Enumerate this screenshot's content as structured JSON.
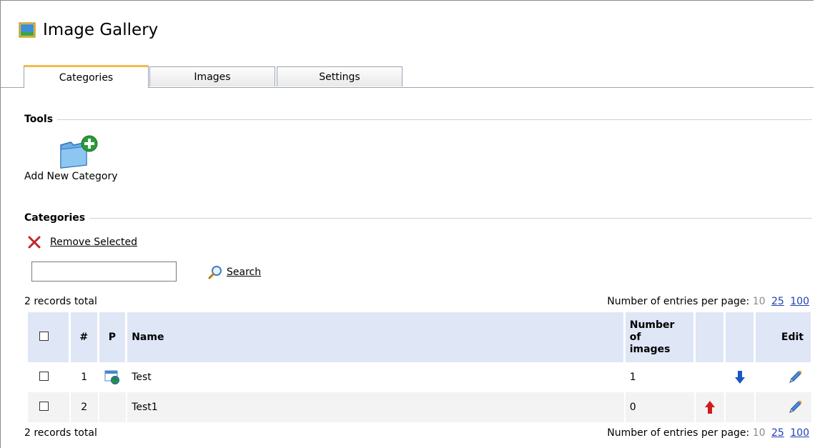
{
  "app": {
    "title": "Image Gallery",
    "icon": "image-gallery-icon"
  },
  "tabs": [
    {
      "label": "Categories",
      "active": true
    },
    {
      "label": "Images",
      "active": false
    },
    {
      "label": "Settings",
      "active": false
    }
  ],
  "tools": {
    "heading": "Tools",
    "add_category_label": "Add New Category"
  },
  "categories": {
    "heading": "Categories",
    "remove_selected_label": "Remove Selected",
    "search_value": "",
    "search_label": "Search",
    "records_total_top": "2 records total",
    "records_total_bottom": "2 records total",
    "per_page_label": "Number of entries per page:",
    "per_page_current": "10",
    "per_page_options": [
      "25",
      "100"
    ],
    "columns": {
      "num": "#",
      "p": "P",
      "name": "Name",
      "images_line1": "Number",
      "images_line2": "of",
      "images_line3": "images",
      "edit": "Edit"
    },
    "rows": [
      {
        "num": "1",
        "has_page_icon": true,
        "name": "Test",
        "images": "1",
        "move": "down"
      },
      {
        "num": "2",
        "has_page_icon": false,
        "name": "Test1",
        "images": "0",
        "move": "up"
      }
    ]
  },
  "colors": {
    "header_bg": "#dfe6f5",
    "tab_accent": "#f4b94c",
    "link": "#1f3fb5",
    "arrow_up": "#d11a1a",
    "arrow_down": "#1a56c4"
  }
}
